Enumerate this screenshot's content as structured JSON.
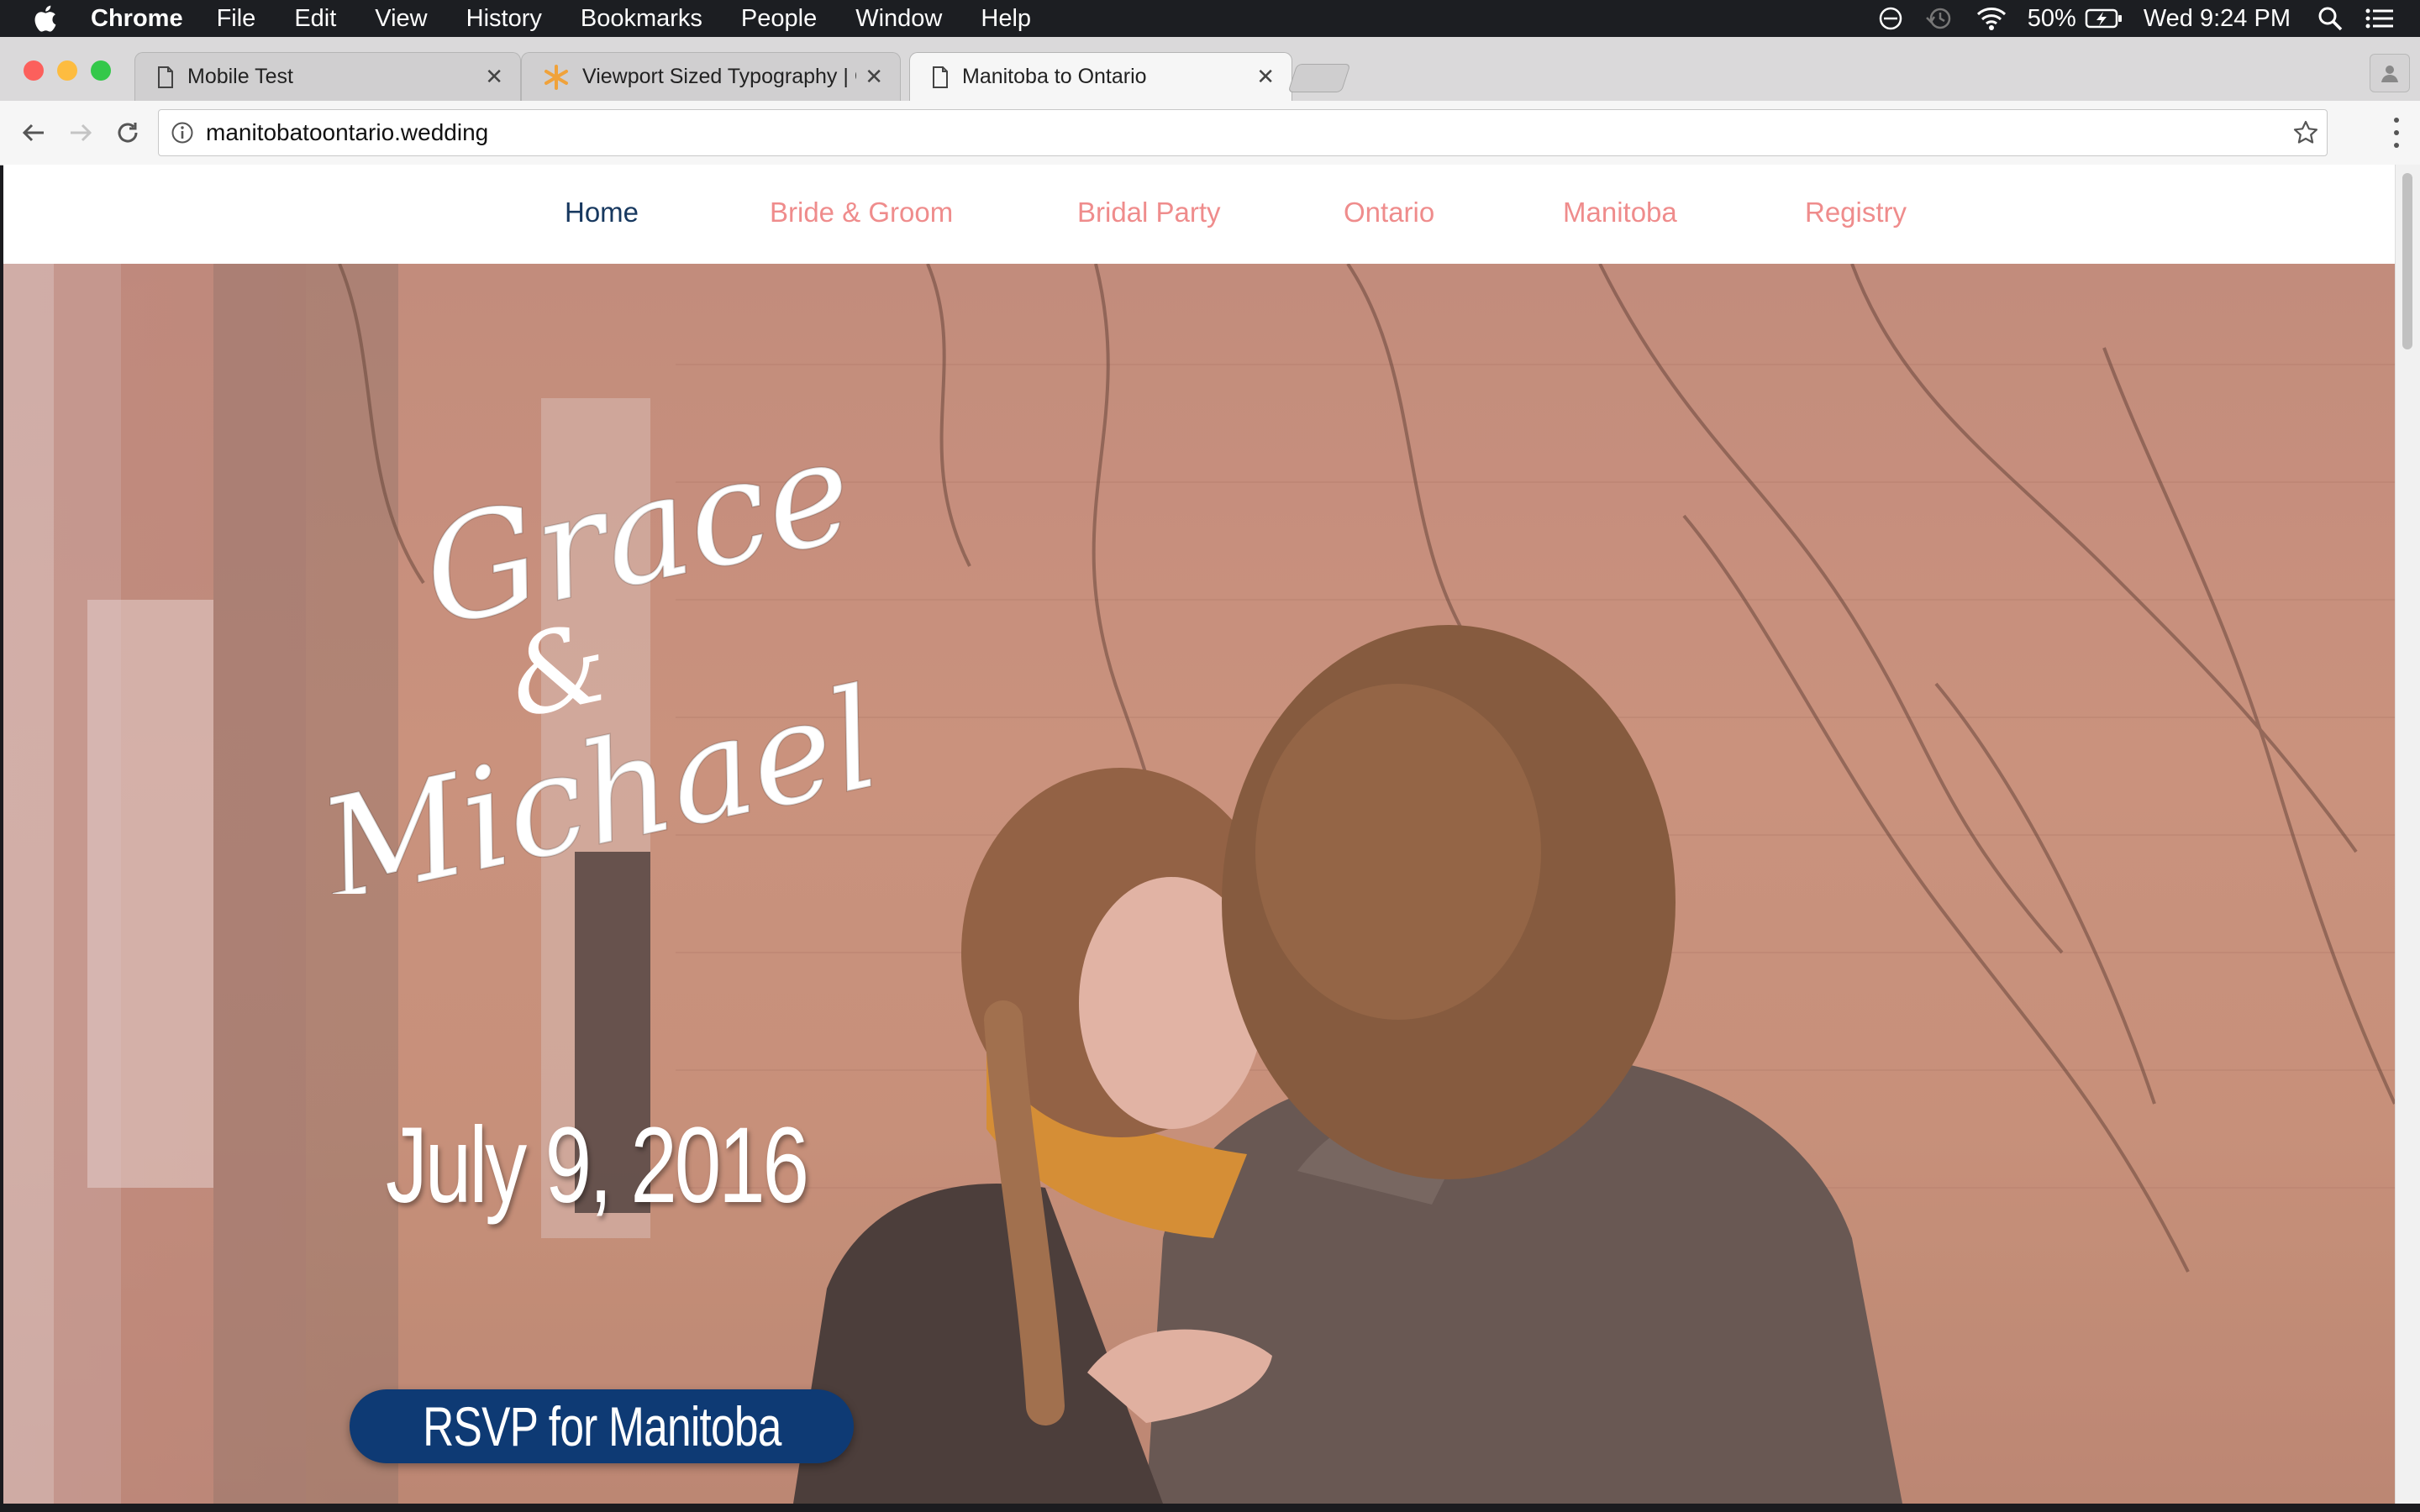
{
  "menubar": {
    "app_name": "Chrome",
    "items": [
      "File",
      "Edit",
      "View",
      "History",
      "Bookmarks",
      "People",
      "Window",
      "Help"
    ],
    "battery": "50%",
    "clock": "Wed 9:24 PM"
  },
  "tabs": [
    {
      "title": "Mobile Test",
      "icon": "page-icon"
    },
    {
      "title": "Viewport Sized Typography | C",
      "icon": "codepen-star-icon"
    },
    {
      "title": "Manitoba to Ontario",
      "icon": "page-icon",
      "active": true
    }
  ],
  "address_bar": {
    "url": "manitobatoontario.wedding"
  },
  "site": {
    "nav": [
      {
        "label": "Home",
        "current": true
      },
      {
        "label": "Bride & Groom"
      },
      {
        "label": "Bridal Party"
      },
      {
        "label": "Ontario"
      },
      {
        "label": "Manitoba"
      },
      {
        "label": "Registry"
      }
    ],
    "hero": {
      "name_1": "Grace",
      "ampersand": "&",
      "name_2": "Michael",
      "date": "July 9, 2016",
      "rsvp_label": "RSVP for Manitoba"
    }
  },
  "colors": {
    "nav_link": "#ef8c8c",
    "nav_current": "#17385f",
    "rsvp_button": "#0e3a74"
  }
}
